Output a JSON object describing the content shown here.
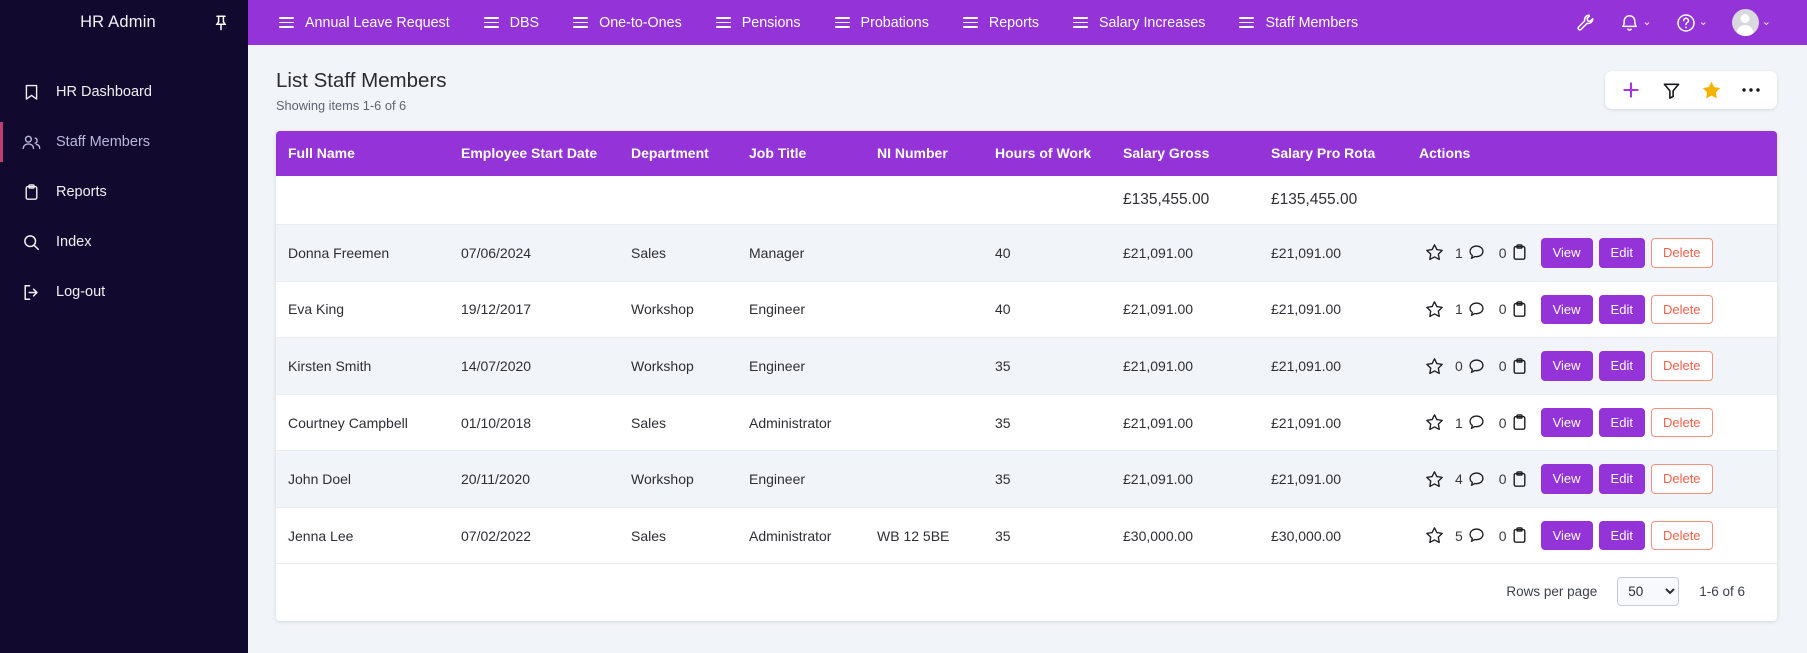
{
  "sidebar": {
    "brand": "HR Admin",
    "pin_icon": "pin-icon",
    "items": [
      {
        "label": "HR Dashboard",
        "icon": "bookmark-icon",
        "active": false
      },
      {
        "label": "Staff Members",
        "icon": "users-icon",
        "active": true
      },
      {
        "label": "Reports",
        "icon": "clipboard-icon",
        "active": false
      },
      {
        "label": "Index",
        "icon": "search-icon",
        "active": false
      },
      {
        "label": "Log-out",
        "icon": "logout-icon",
        "active": false
      }
    ]
  },
  "topbar": {
    "items": [
      {
        "label": "Annual Leave Request",
        "icon": "menu-icon"
      },
      {
        "label": "DBS",
        "icon": "menu-icon"
      },
      {
        "label": "One-to-Ones",
        "icon": "menu-icon"
      },
      {
        "label": "Pensions",
        "icon": "menu-icon"
      },
      {
        "label": "Probations",
        "icon": "menu-icon"
      },
      {
        "label": "Reports",
        "icon": "menu-icon"
      },
      {
        "label": "Salary Increases",
        "icon": "menu-icon"
      },
      {
        "label": "Staff Members",
        "icon": "menu-icon"
      }
    ],
    "right": {
      "wrench_icon": "wrench-icon",
      "bell_icon": "bell-icon",
      "help_icon": "help-circle-icon",
      "avatar_icon": "avatar-icon",
      "chevron": "⌄"
    },
    "bg_color": "#9333d8"
  },
  "page": {
    "title": "List Staff Members",
    "subtitle": "Showing items 1-6 of 6"
  },
  "toolbar": {
    "add_icon": "plus-icon",
    "filter_icon": "filter-icon",
    "favourite_icon": "star-icon",
    "more_icon": "ellipsis-icon",
    "add_color": "#a435e0",
    "star_color": "#f5b301"
  },
  "table": {
    "columns": [
      "Full Name",
      "Employee Start Date",
      "Department",
      "Job Title",
      "NI Number",
      "Hours of Work",
      "Salary Gross",
      "Salary Pro Rota",
      "Actions"
    ],
    "totals": {
      "salary_gross": "£135,455.00",
      "salary_pro_rota": "£135,455.00"
    },
    "rows": [
      {
        "full_name": "Donna Freemen",
        "start_date": "07/06/2024",
        "department": "Sales",
        "job_title": "Manager",
        "ni_number": "",
        "hours": "40",
        "salary_gross": "£21,091.00",
        "salary_pro_rota": "£21,091.00",
        "comments": "1",
        "tasks": "0"
      },
      {
        "full_name": "Eva King",
        "start_date": "19/12/2017",
        "department": "Workshop",
        "job_title": "Engineer",
        "ni_number": "",
        "hours": "40",
        "salary_gross": "£21,091.00",
        "salary_pro_rota": "£21,091.00",
        "comments": "1",
        "tasks": "0"
      },
      {
        "full_name": "Kirsten Smith",
        "start_date": "14/07/2020",
        "department": "Workshop",
        "job_title": "Engineer",
        "ni_number": "",
        "hours": "35",
        "salary_gross": "£21,091.00",
        "salary_pro_rota": "£21,091.00",
        "comments": "0",
        "tasks": "0"
      },
      {
        "full_name": "Courtney Campbell",
        "start_date": "01/10/2018",
        "department": "Sales",
        "job_title": "Administrator",
        "ni_number": "",
        "hours": "35",
        "salary_gross": "£21,091.00",
        "salary_pro_rota": "£21,091.00",
        "comments": "1",
        "tasks": "0"
      },
      {
        "full_name": "John Doel",
        "start_date": "20/11/2020",
        "department": "Workshop",
        "job_title": "Engineer",
        "ni_number": "",
        "hours": "35",
        "salary_gross": "£21,091.00",
        "salary_pro_rota": "£21,091.00",
        "comments": "4",
        "tasks": "0"
      },
      {
        "full_name": "Jenna Lee",
        "start_date": "07/02/2022",
        "department": "Sales",
        "job_title": "Administrator",
        "ni_number": "WB 12 5BE",
        "hours": "35",
        "salary_gross": "£30,000.00",
        "salary_pro_rota": "£30,000.00",
        "comments": "5",
        "tasks": "0"
      }
    ],
    "row_actions": {
      "view": "View",
      "edit": "Edit",
      "delete": "Delete"
    }
  },
  "footer": {
    "rows_per_page_label": "Rows per page",
    "rows_per_page_value": "50",
    "rows_per_page_options": [
      "50"
    ],
    "range": "1-6 of 6"
  }
}
